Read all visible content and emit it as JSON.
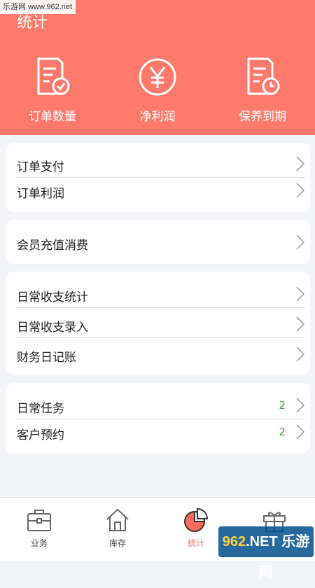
{
  "watermark": {
    "top": "乐游网 www.962.net",
    "bottom_num": "962",
    "bottom_rest": ".NET 乐游网"
  },
  "header": {
    "title": "统计",
    "quick_actions": [
      {
        "label": "订单数量",
        "icon": "order-check-icon"
      },
      {
        "label": "净利润",
        "icon": "yen-circle-icon"
      },
      {
        "label": "保养到期",
        "icon": "document-clock-icon"
      }
    ]
  },
  "groups": [
    {
      "items": [
        {
          "label": "订单支付"
        },
        {
          "label": "订单利润"
        }
      ]
    },
    {
      "items": [
        {
          "label": "会员充值消费"
        }
      ]
    },
    {
      "items": [
        {
          "label": "日常收支统计"
        },
        {
          "label": "日常收支录入"
        },
        {
          "label": "财务日记账"
        }
      ]
    },
    {
      "items": [
        {
          "label": "日常任务",
          "count": "2"
        },
        {
          "label": "客户预约",
          "count": "2"
        }
      ]
    }
  ],
  "tabs": [
    {
      "label": "业务",
      "icon": "briefcase-icon",
      "active": false
    },
    {
      "label": "库存",
      "icon": "house-icon",
      "active": false
    },
    {
      "label": "统计",
      "icon": "pie-chart-icon",
      "active": true
    },
    {
      "label": "",
      "icon": "gift-icon",
      "active": false
    }
  ],
  "colors": {
    "accent": "#ff7a6b",
    "active_tab": "#ff6b5b",
    "count": "#3aaa35",
    "background": "#f2f4f8"
  }
}
